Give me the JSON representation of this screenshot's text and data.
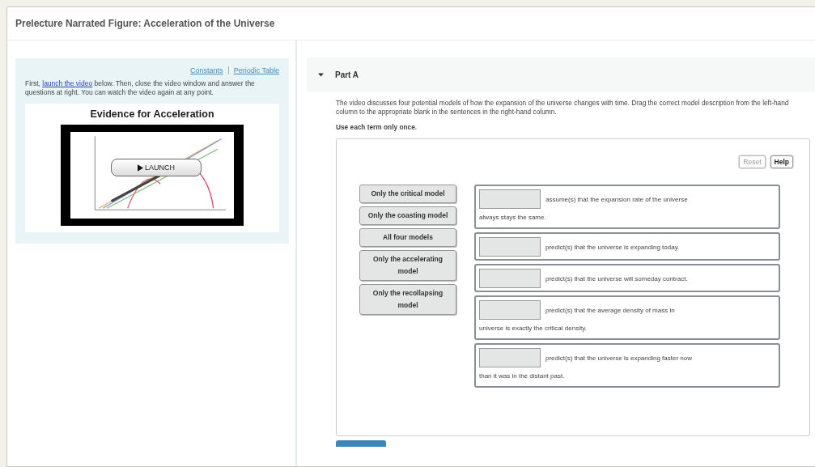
{
  "window": {
    "title": "Prelecture Narrated Figure: Acceleration of the Universe"
  },
  "sidebar": {
    "links": [
      "Constants",
      "Periodic Table"
    ],
    "intro_parts": [
      "First, ",
      "launch the video",
      " below. Then, close the video window and answer the questions at right. You can watch the video again at any point."
    ],
    "video": {
      "title": "Evidence for Acceleration",
      "launch_label": "LAUNCH",
      "kind": "picture"
    }
  },
  "part": {
    "title": "Part A",
    "expanded": true,
    "description": "The video discusses four potential models of how the expansion of the universe changes with time. Drag the correct model description from the left-hand column to the appropriate blank in the sentences in the right-hand column.",
    "instruction": "Use each term only once.",
    "buttons": [
      {
        "label": "Reset",
        "disabled": true
      },
      {
        "label": "Help",
        "disabled": false
      }
    ],
    "terms": [
      "Only the critical model",
      "Only the coasting model",
      "All four models",
      "Only the accelerating model",
      "Only the recollapsing model"
    ],
    "sentences": [
      {
        "line_1": "assume(s) that the expansion rate of the universe",
        "line_2": "always stays the same."
      },
      {
        "line_1": "predict(s) that the universe is expanding today."
      },
      {
        "line_1": "predict(s) that the universe will someday contract."
      },
      {
        "line_1": "predict(s) that the average density of mass in",
        "line_2": "universe is exactly the critical density."
      },
      {
        "line_1": "predict(s) that the universe is expanding faster now",
        "line_2": "than it was in the distant past."
      }
    ]
  }
}
